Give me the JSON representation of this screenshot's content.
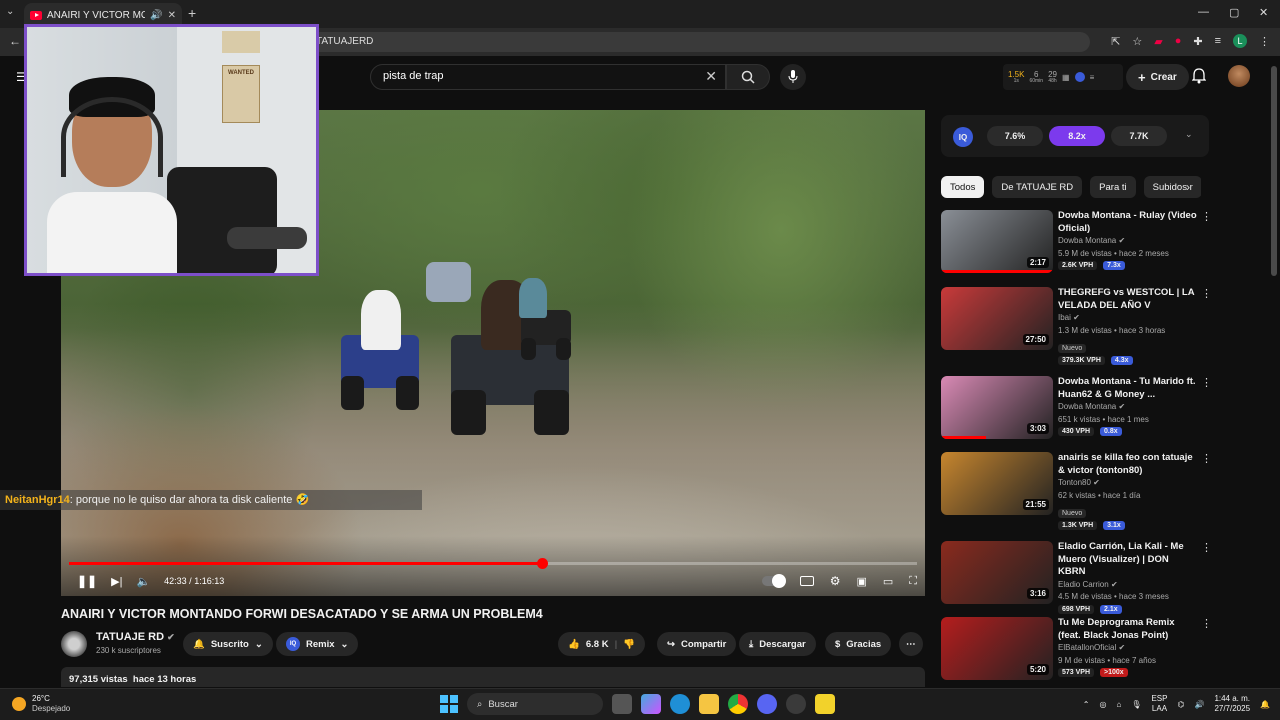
{
  "browser": {
    "tab_title": "ANAIRI Y VICTOR MONTANDO",
    "new_tab": "+",
    "url_fragment": "TATUAJERD",
    "window_controls": [
      "—",
      "▢",
      "✕"
    ]
  },
  "header": {
    "search_value": "pista de trap",
    "stats": {
      "subs": "1.5K",
      "subs_sub": "1s",
      "views": "6",
      "views_sub": "60min",
      "vph": "29",
      "vph_sub": "48h"
    },
    "create_label": "Crear"
  },
  "webcam": {
    "poster_text": "WANTED"
  },
  "player": {
    "time_current": "42:33",
    "time_total": "1:16:13",
    "progress_fraction": 0.558,
    "hover_fraction": 0.379
  },
  "chat": {
    "username": "NeitanHgr14",
    "message": ": porque no le quiso dar ahora ta disk caliente 🤣"
  },
  "video": {
    "title": "ANAIRI Y VICTOR MONTANDO FORWI DESACATADO Y SE ARMA UN PROBLEM4",
    "channel": "TATUAJE RD",
    "subscribers": "230 k suscriptores",
    "subscribed_label": "Suscrito",
    "remix_label": "Remix",
    "likes": "6.8 K",
    "share_label": "Compartir",
    "download_label": "Descargar",
    "thanks_label": "Gracias",
    "views": "97,315 vistas",
    "age": "hace 13 horas"
  },
  "iq": {
    "logo": "IQ",
    "values": [
      "7.6%",
      "8.2x",
      "7.7K"
    ]
  },
  "chips": [
    "Todos",
    "De TATUAJE RD",
    "Para ti",
    "Subidos r"
  ],
  "recommendations": [
    {
      "title": "Dowba Montana - Rulay (Video Oficial)",
      "channel": "Dowba Montana",
      "info": "5.9 M de vistas • hace 2 meses",
      "duration": "2:17",
      "vph": "2.6K VPH",
      "mult": "7.3x",
      "nuevo": "",
      "color": "#8a8f96"
    },
    {
      "title": "THEGREFG vs WESTCOL | LA VELADA DEL AÑO V",
      "channel": "Ibai",
      "info": "1.3 M de vistas • hace 3 horas",
      "duration": "27:50",
      "vph": "379.3K VPH",
      "mult": "4.3x",
      "nuevo": "Nuevo",
      "color": "#c93a3a"
    },
    {
      "title": "Dowba Montana - Tu Marido ft. Huan62 & G Money ...",
      "channel": "Dowba Montana",
      "info": "651 k vistas • hace 1 mes",
      "duration": "3:03",
      "vph": "430 VPH",
      "mult": "0.8x",
      "nuevo": "",
      "color": "#d98ab5"
    },
    {
      "title": "anairis se killa feo con tatuaje & victor (tonton80)",
      "channel": "Tonton80",
      "info": "62 k vistas • hace 1 día",
      "duration": "21:55",
      "vph": "1.3K VPH",
      "mult": "3.1x",
      "nuevo": "Nuevo",
      "color": "#c7862e"
    },
    {
      "title": "Eladio Carrión, Lia Kali - Me Muero (Visualizer) | DON KBRN",
      "channel": "Eladio Carrion",
      "info": "4.5 M de vistas • hace 3 meses",
      "duration": "3:16",
      "vph": "698 VPH",
      "mult": "2.1x",
      "nuevo": "",
      "color": "#8a2a1e"
    },
    {
      "title": "Tu Me Deprograma Remix (feat. Black Jonas Point)",
      "channel": "ElBatallonOficial",
      "info": "9 M de vistas • hace 7 años",
      "duration": "5:20",
      "vph": "573 VPH",
      "mult": ">100x",
      "nuevo": "",
      "color": "#b51d1d"
    }
  ],
  "taskbar": {
    "temp": "26°C",
    "weather": "Despejado",
    "search": "Buscar",
    "lang1": "ESP",
    "lang2": "LAA",
    "time": "1:44 a. m.",
    "date": "27/7/2025"
  }
}
